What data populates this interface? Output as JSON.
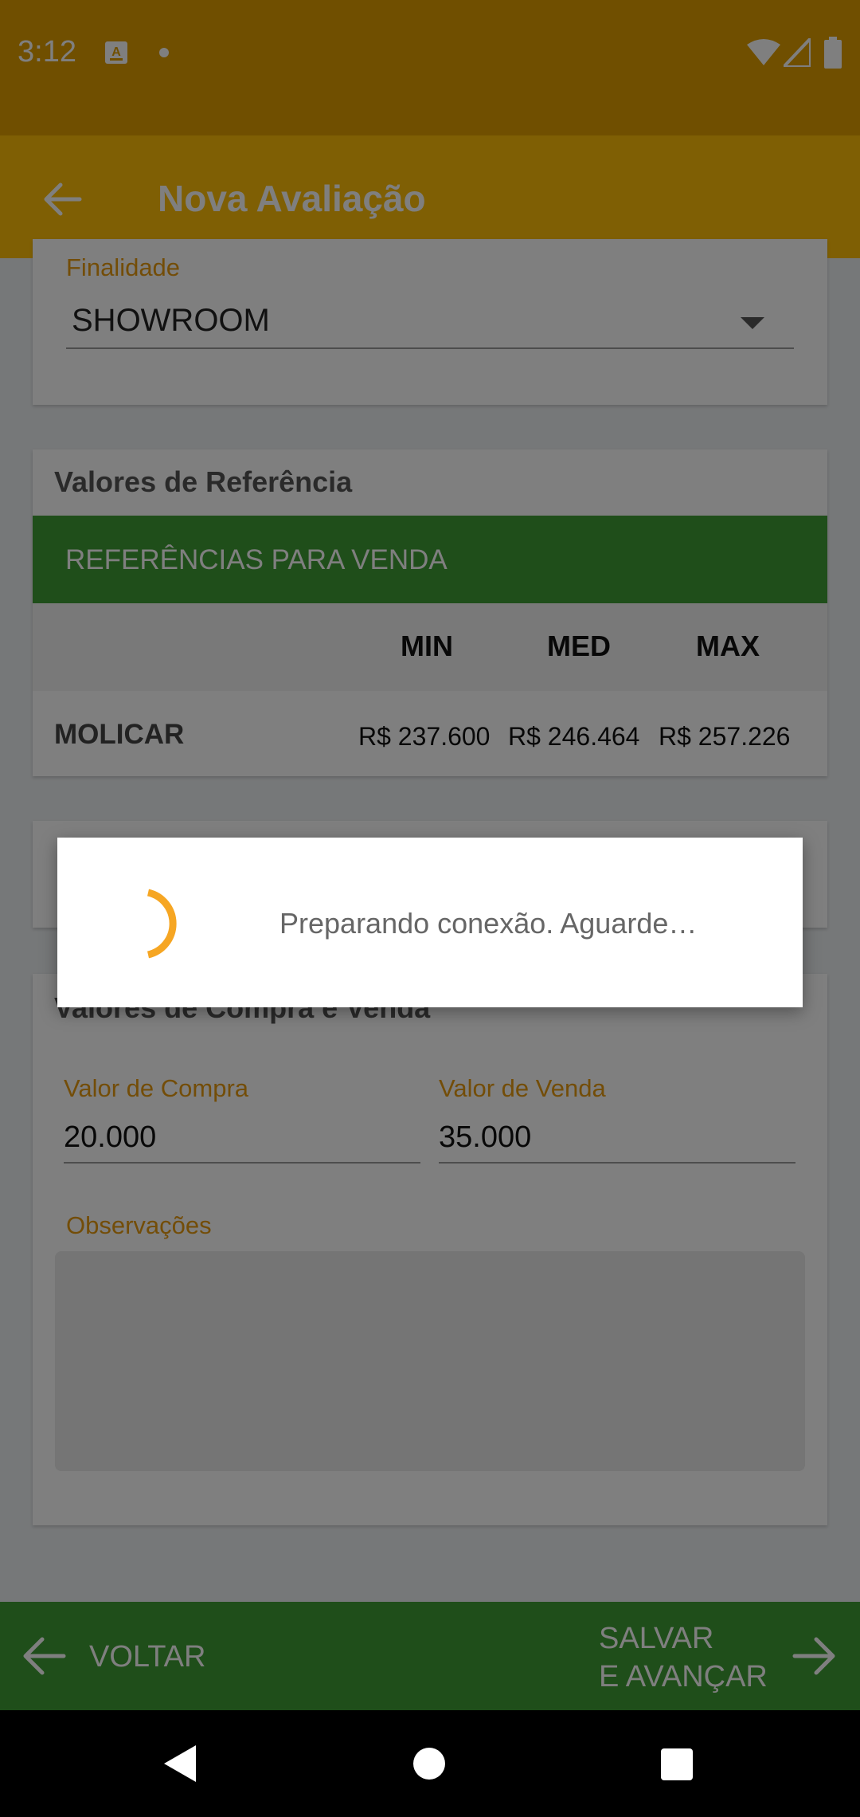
{
  "status_bar": {
    "time": "3:12",
    "notification_icon": "a-keyboard-icon"
  },
  "toolbar": {
    "title": "Nova Avaliação"
  },
  "finalidade": {
    "label": "Finalidade",
    "value": "SHOWROOM"
  },
  "referencias": {
    "title": "Valores de Referência",
    "banner": "REFERÊNCIAS PARA VENDA",
    "columns": [
      "MIN",
      "MED",
      "MAX"
    ],
    "rows": [
      {
        "label": "MOLICAR",
        "values": [
          "R$  237.600",
          "R$  246.464",
          "R$  257.226"
        ]
      }
    ]
  },
  "compra_venda": {
    "title": "Valores de Compra e Venda",
    "compra_label": "Valor de Compra",
    "compra_value": "20.000",
    "venda_label": "Valor de Venda",
    "venda_value": "35.000",
    "obs_label": "Observações"
  },
  "bottom_bar": {
    "back_label": "VOLTAR",
    "next_line1": "SALVAR",
    "next_line2": "E AVANÇAR"
  },
  "dialog": {
    "message": "Preparando conexão. Aguarde…"
  },
  "colors": {
    "primary": "#ffbf08",
    "primary_dark": "#e09e00",
    "green": "#3f9c35",
    "accent_label": "#e79a10"
  }
}
